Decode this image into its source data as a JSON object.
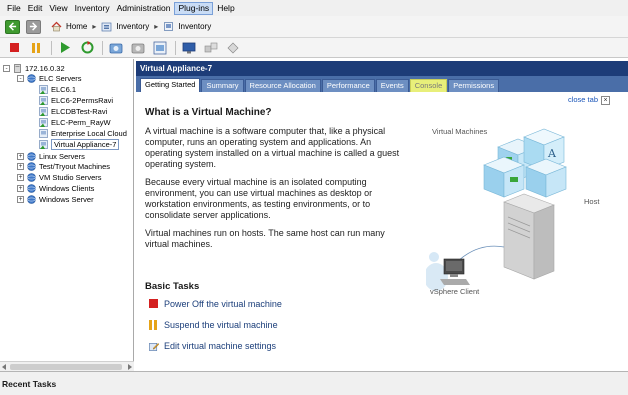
{
  "menu": {
    "items": [
      "File",
      "Edit",
      "View",
      "Inventory",
      "Administration",
      "Plug-ins",
      "Help"
    ],
    "active_index": 5
  },
  "nav": {
    "crumbs": [
      "Home",
      "Inventory",
      "Inventory"
    ]
  },
  "tree": {
    "root": "172.16.0.32",
    "items": [
      {
        "label": "ELC Servers",
        "level": 1,
        "expander": "-",
        "icon": "cluster-icon"
      },
      {
        "label": "ELC6.1",
        "level": 2,
        "expander": "",
        "icon": "vm-icon"
      },
      {
        "label": "ELC6-2PermsRavi",
        "level": 2,
        "expander": "",
        "icon": "vm-icon"
      },
      {
        "label": "ELCDBTest-Ravi",
        "level": 2,
        "expander": "",
        "icon": "vm-icon"
      },
      {
        "label": "ELC-Perm_RayW",
        "level": 2,
        "expander": "",
        "icon": "vm-icon"
      },
      {
        "label": "Enterprise Local Cloud",
        "level": 2,
        "expander": "",
        "icon": "vm-off-icon"
      },
      {
        "label": "Virtual Appliance-7",
        "level": 2,
        "expander": "",
        "icon": "vm-icon",
        "selected": true
      },
      {
        "label": "Linux Servers",
        "level": 1,
        "expander": "+",
        "icon": "cluster-icon"
      },
      {
        "label": "Test/Tryout Machines",
        "level": 1,
        "expander": "+",
        "icon": "cluster-icon"
      },
      {
        "label": "VM Studio Servers",
        "level": 1,
        "expander": "+",
        "icon": "cluster-icon"
      },
      {
        "label": "Windows Clients",
        "level": 1,
        "expander": "+",
        "icon": "cluster-icon"
      },
      {
        "label": "Windows Server",
        "level": 1,
        "expander": "+",
        "icon": "cluster-icon"
      }
    ]
  },
  "main": {
    "object_title": "Virtual Appliance-7",
    "tabs": [
      "Getting Started",
      "Summary",
      "Resource Allocation",
      "Performance",
      "Events",
      "Console",
      "Permissions"
    ],
    "active_tab": 0,
    "highlight_tab": 5,
    "close_tab": "close tab",
    "heading": "What is a Virtual Machine?",
    "paragraphs": [
      "A virtual machine is a software computer that, like a physical computer, runs an operating system and applications. An operating system installed on a virtual machine is called a guest operating system.",
      "Because every virtual machine is an isolated computing environment, you can use virtual machines as desktop or workstation environments, as testing environments, or to consolidate server applications.",
      "Virtual machines run on hosts. The same host can run many virtual machines."
    ],
    "illustration": {
      "vm_label": "Virtual Machines",
      "host_label": "Host",
      "client_label": "vSphere Client"
    },
    "basic_tasks_heading": "Basic Tasks",
    "tasks": [
      {
        "label": "Power Off the virtual machine",
        "icon": "power-off-icon"
      },
      {
        "label": "Suspend the virtual machine",
        "icon": "suspend-icon"
      },
      {
        "label": "Edit virtual machine settings",
        "icon": "edit-settings-icon"
      }
    ]
  },
  "bottom": {
    "recent_tasks": "Recent Tasks"
  },
  "colors": {
    "header_bg": "#1d3c78",
    "tab_strip": "#4a6ea8",
    "console_highlight": "#e8ef7a",
    "link": "#1b3e7a"
  }
}
